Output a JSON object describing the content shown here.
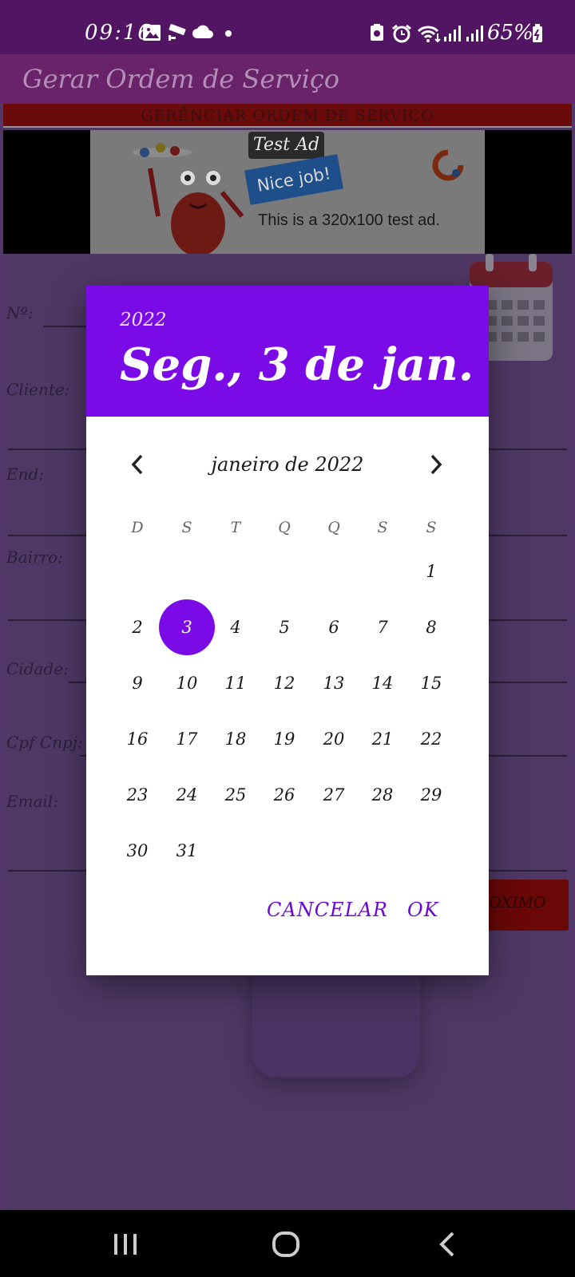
{
  "status_bar": {
    "time": "09:16",
    "battery": "65%"
  },
  "app_bar": {
    "title": "Gerar Ordem de Serviço"
  },
  "section_header": "GERÊNCIAR ORDEM DE SERVIÇO",
  "ad": {
    "badge": "Test Ad",
    "headline": "Nice job!",
    "caption": "This is a 320x100 test ad."
  },
  "form": {
    "labels": {
      "numero": "Nº:",
      "cliente": "Cliente:",
      "endereco": "End:",
      "bairro": "Bairro:",
      "cidade": "Cidade:",
      "cpf_cnpj": "Cpf Cnpj:",
      "email": "Email:"
    },
    "next_button": "ROXIMO"
  },
  "dialog": {
    "year": "2022",
    "selected_date": "Seg., 3 de jan.",
    "month_label": "janeiro de 2022",
    "weekdays": [
      "D",
      "S",
      "T",
      "Q",
      "Q",
      "S",
      "S"
    ],
    "first_weekday_index": 6,
    "days_in_month": 31,
    "selected_day": 3,
    "cancel_label": "CANCELAR",
    "ok_label": "OK"
  },
  "colors": {
    "status_bar": "#521563",
    "app_bar": "#692469",
    "dialog_accent": "#7a0be6",
    "button_text": "#6a0ad6",
    "section_header": "#6b0a0a"
  }
}
